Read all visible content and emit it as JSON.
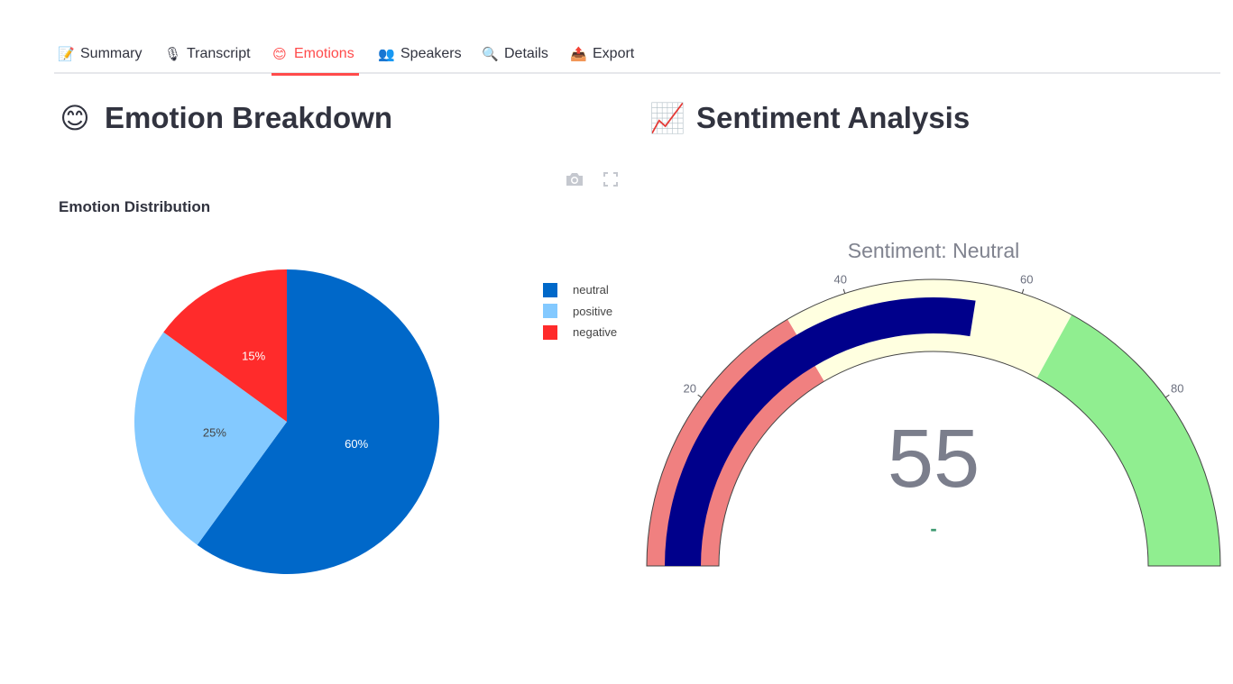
{
  "tabs": [
    {
      "icon": "📝",
      "label": "Summary"
    },
    {
      "icon": "🎙",
      "label": "Transcript"
    },
    {
      "icon": "😊",
      "label": "Emotions"
    },
    {
      "icon": "👥",
      "label": "Speakers"
    },
    {
      "icon": "🔍",
      "label": "Details"
    },
    {
      "icon": "📤",
      "label": "Export"
    }
  ],
  "active_tab": "Emotions",
  "sections": {
    "emotion": {
      "icon": "😊",
      "title": "Emotion Breakdown"
    },
    "sentiment": {
      "icon": "📈",
      "title": "Sentiment Analysis"
    }
  },
  "toolbar": {
    "camera_icon": "camera-icon",
    "fullscreen_icon": "fullscreen-icon"
  },
  "chart_data": [
    {
      "type": "pie",
      "title": "Emotion Distribution",
      "legend_position": "right",
      "slices": [
        {
          "label": "neutral",
          "value": 60,
          "text": "60%",
          "color": "#0068c9"
        },
        {
          "label": "positive",
          "value": 25,
          "text": "25%",
          "color": "#83c9ff"
        },
        {
          "label": "negative",
          "value": 15,
          "text": "15%",
          "color": "#ff2b2b"
        }
      ]
    },
    {
      "type": "gauge",
      "title": "Sentiment: Neutral",
      "value": 55,
      "delta_text": "-",
      "range": [
        0,
        100
      ],
      "ticks": [
        20,
        40,
        60,
        80
      ],
      "bar_color": "#00008b",
      "steps": [
        {
          "range": [
            0,
            33
          ],
          "color": "#f08080"
        },
        {
          "range": [
            33,
            66
          ],
          "color": "#ffffe0"
        },
        {
          "range": [
            66,
            100
          ],
          "color": "#90ee90"
        }
      ]
    }
  ]
}
